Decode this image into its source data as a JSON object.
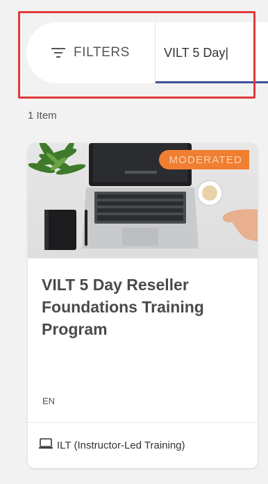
{
  "toolbar": {
    "filters_label": "FILTERS",
    "filters_icon": "filter-lines-icon",
    "search_value": "VILT 5 Day|"
  },
  "results": {
    "count_text": "1 Item"
  },
  "card": {
    "badge": "MODERATED",
    "title": "VILT 5 Day Reseller Foundations Training Program",
    "language": "EN",
    "type_icon": "monitor-icon",
    "type_label": "ILT (Instructor-Led Training)"
  },
  "colors": {
    "background": "#f2f2f2",
    "highlight": "#e03a3a",
    "badge": "#f07f32",
    "search_underline": "#3f4f9a"
  }
}
